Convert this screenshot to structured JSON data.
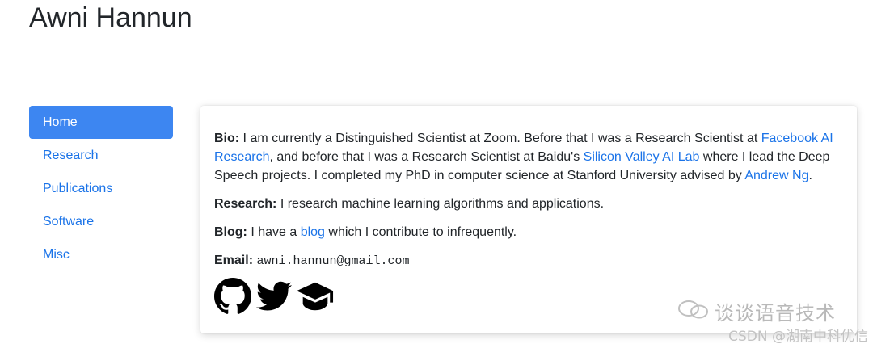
{
  "header": {
    "title": "Awni Hannun"
  },
  "nav": {
    "items": [
      {
        "label": "Home",
        "active": true
      },
      {
        "label": "Research"
      },
      {
        "label": "Publications"
      },
      {
        "label": "Software"
      },
      {
        "label": "Misc"
      }
    ]
  },
  "bio": {
    "label": "Bio:",
    "text_1": " I am currently a Distinguished Scientist at Zoom. Before that I was a Research Scientist at ",
    "link_1": "Facebook AI Research",
    "text_2": ", and before that I was a Research Scientist at Baidu's ",
    "link_2": "Silicon Valley AI Lab",
    "text_3": " where I lead the Deep Speech projects. I completed my PhD in computer science at Stanford University advised by ",
    "link_3": "Andrew Ng",
    "text_4": "."
  },
  "research": {
    "label": "Research:",
    "text": " I research machine learning algorithms and applications."
  },
  "blog": {
    "label": "Blog:",
    "text_1": " I have a ",
    "link": "blog",
    "text_2": " which I contribute to infrequently."
  },
  "email": {
    "label": "Email:",
    "address": "awni.hannun@gmail.com"
  },
  "icons": [
    "github-icon",
    "twitter-icon",
    "graduation-cap-icon"
  ],
  "watermark": {
    "channel": "谈谈语音技术",
    "credit": "CSDN @湖南中科优信"
  },
  "colors": {
    "link": "#1a73e8",
    "active_nav_bg": "#3d86f1"
  }
}
